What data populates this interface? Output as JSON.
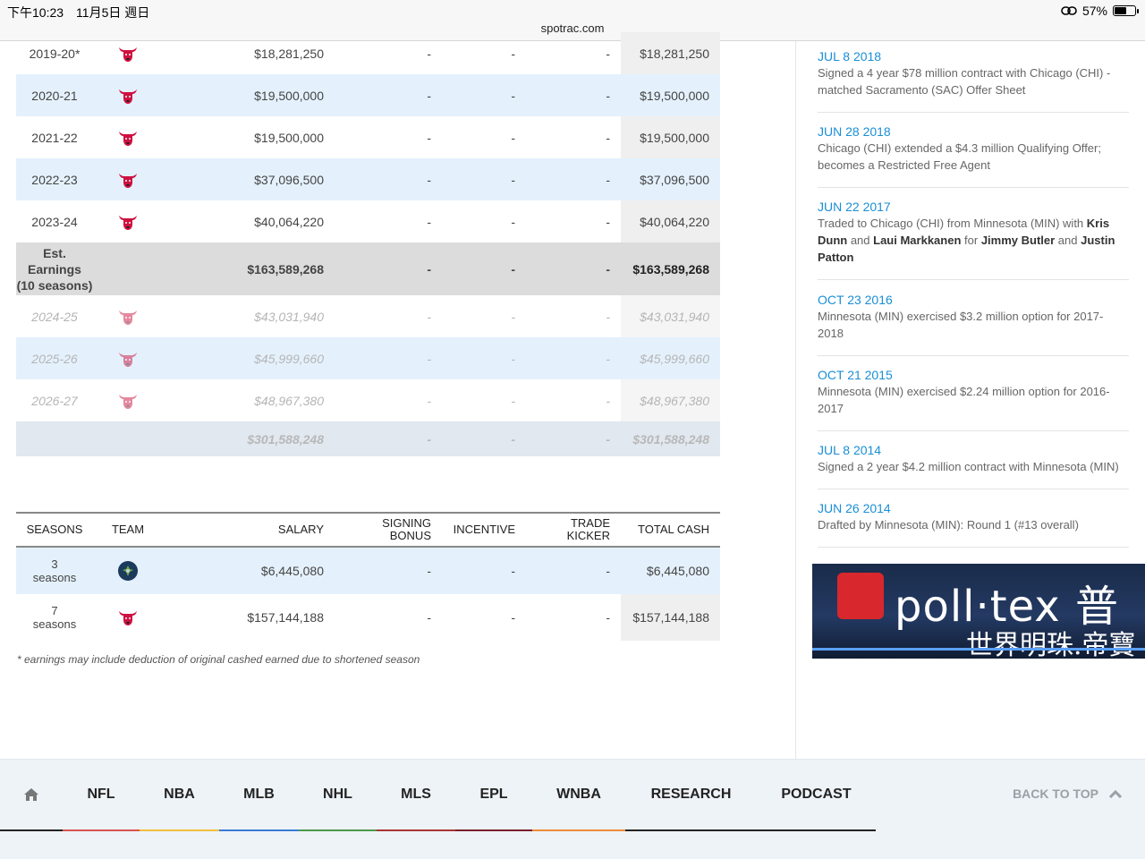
{
  "status_bar": {
    "time": "下午10:23　11月5日 週日",
    "battery": "57%",
    "battery_level": 0.57,
    "url": "spotrac.com"
  },
  "contract_rows": [
    {
      "season": "2019-20*",
      "salary": "$18,281,250",
      "signing": "-",
      "incentive": "-",
      "kicker": "-",
      "total": "$18,281,250"
    },
    {
      "season": "2020-21",
      "salary": "$19,500,000",
      "signing": "-",
      "incentive": "-",
      "kicker": "-",
      "total": "$19,500,000"
    },
    {
      "season": "2021-22",
      "salary": "$19,500,000",
      "signing": "-",
      "incentive": "-",
      "kicker": "-",
      "total": "$19,500,000"
    },
    {
      "season": "2022-23",
      "salary": "$37,096,500",
      "signing": "-",
      "incentive": "-",
      "kicker": "-",
      "total": "$37,096,500"
    },
    {
      "season": "2023-24",
      "salary": "$40,064,220",
      "signing": "-",
      "incentive": "-",
      "kicker": "-",
      "total": "$40,064,220"
    }
  ],
  "est_earnings": {
    "label_line1": "Est. Earnings",
    "label_line2": "(10 seasons)",
    "salary": "$163,589,268",
    "signing": "-",
    "incentive": "-",
    "kicker": "-",
    "total": "$163,589,268"
  },
  "future_rows": [
    {
      "season": "2024-25",
      "salary": "$43,031,940",
      "signing": "-",
      "incentive": "-",
      "kicker": "-",
      "total": "$43,031,940"
    },
    {
      "season": "2025-26",
      "salary": "$45,999,660",
      "signing": "-",
      "incentive": "-",
      "kicker": "-",
      "total": "$45,999,660"
    },
    {
      "season": "2026-27",
      "salary": "$48,967,380",
      "signing": "-",
      "incentive": "-",
      "kicker": "-",
      "total": "$48,967,380"
    }
  ],
  "future_total": {
    "salary": "$301,588,248",
    "signing": "-",
    "incentive": "-",
    "kicker": "-",
    "total": "$301,588,248"
  },
  "summary": {
    "headers": {
      "seasons": "SEASONS",
      "team": "TEAM",
      "salary": "SALARY",
      "signing_1": "SIGNING",
      "signing_2": "BONUS",
      "incentive": "INCENTIVE",
      "kicker_1": "TRADE",
      "kicker_2": "KICKER",
      "total": "TOTAL CASH"
    },
    "rows": [
      {
        "count": "3",
        "unit": "seasons",
        "team": "Minnesota",
        "salary": "$6,445,080",
        "signing": "-",
        "incentive": "-",
        "kicker": "-",
        "total": "$6,445,080"
      },
      {
        "count": "7",
        "unit": "seasons",
        "team": "Chicago",
        "salary": "$157,144,188",
        "signing": "-",
        "incentive": "-",
        "kicker": "-",
        "total": "$157,144,188"
      }
    ]
  },
  "footnote": "* earnings may include deduction of original cashed earned due to shortened season",
  "transactions": [
    {
      "date": "JUL 8 2018",
      "text": "Signed a 4 year $78 million contract with Chicago (CHI) - matched Sacramento (SAC) Offer Sheet"
    },
    {
      "date": "JUN 28 2018",
      "text": "Chicago (CHI) extended a $4.3 million Qualifying Offer; becomes a Restricted Free Agent"
    },
    {
      "date": "JUN 22 2017",
      "t1": "Traded to Chicago (CHI) from Minnesota (MIN) with ",
      "b1": "Kris Dunn",
      "t2": " and ",
      "b2": "Laui Markkanen",
      "t3": " for ",
      "b3": "Jimmy Butler",
      "t4": " and ",
      "b4": "Justin Patton"
    },
    {
      "date": "OCT 23 2016",
      "text": "Minnesota (MIN) exercised $3.2 million option for 2017-2018"
    },
    {
      "date": "OCT 21 2015",
      "text": "Minnesota (MIN) exercised $2.24 million option for 2016-2017"
    },
    {
      "date": "JUL 8 2014",
      "text": "Signed a 2 year $4.2 million contract with Minnesota (MIN)"
    },
    {
      "date": "JUN 26 2014",
      "text": "Drafted by Minnesota (MIN): Round 1 (#13 overall)"
    }
  ],
  "ad": {
    "brand": "poll·tex 普",
    "tagline": "世界明珠.帝寶"
  },
  "footer": {
    "nav": [
      {
        "label": "NFL",
        "color": "#d9534f"
      },
      {
        "label": "NBA",
        "color": "#f0c040"
      },
      {
        "label": "MLB",
        "color": "#3a7bd5"
      },
      {
        "label": "NHL",
        "color": "#4a9a4a"
      },
      {
        "label": "MLS",
        "color": "#a33"
      },
      {
        "label": "EPL",
        "color": "#7a1f2b"
      },
      {
        "label": "WNBA",
        "color": "#f08a3a"
      },
      {
        "label": "RESEARCH",
        "color": "#222"
      },
      {
        "label": "PODCAST",
        "color": "#222"
      }
    ],
    "back_to_top": "BACK TO TOP"
  },
  "icons": {
    "home": "home-icon",
    "bulls": "chicago-bulls-logo-icon",
    "wolves": "minnesota-timberwolves-logo-icon",
    "chevron": "chevron-up-icon"
  },
  "colors": {
    "link": "#1a8fd6",
    "row_alt": "#e4f1fc",
    "est_bg": "#dcdcdc",
    "bulls_red": "#ce1141"
  }
}
